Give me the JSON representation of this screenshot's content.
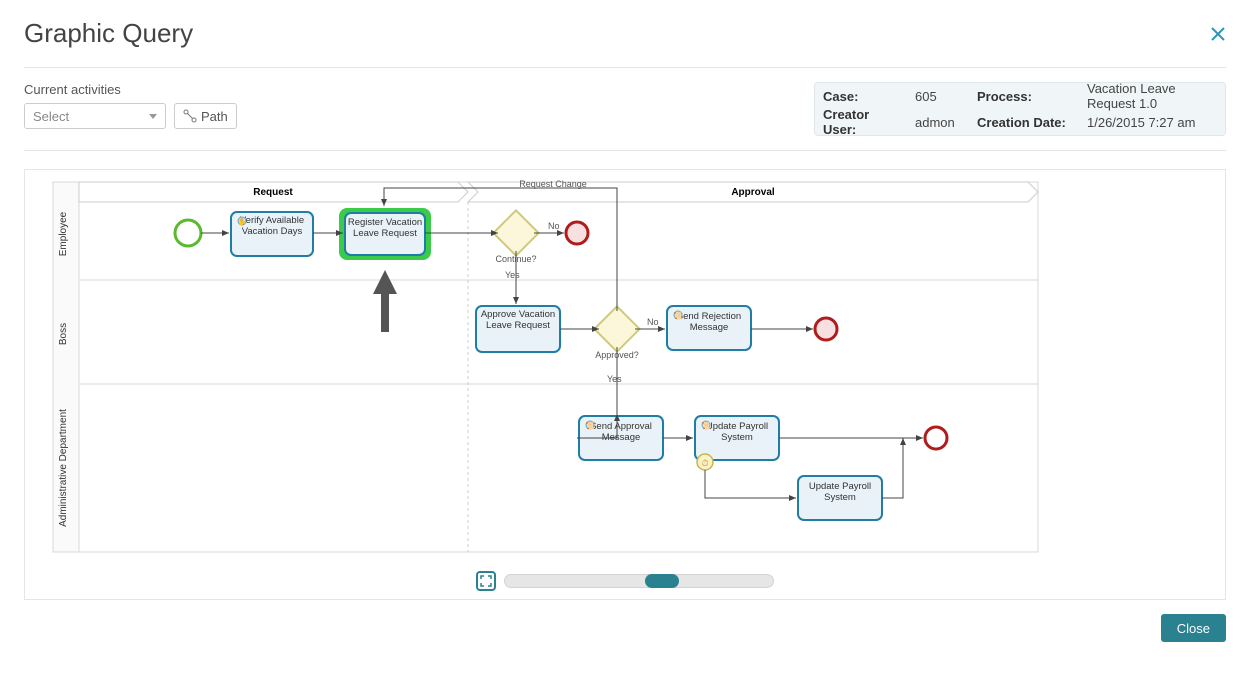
{
  "title": "Graphic Query",
  "controls": {
    "activities_label": "Current activities",
    "select_placeholder": "Select",
    "path_label": "Path"
  },
  "info": {
    "case_label": "Case:",
    "case_value": "605",
    "process_label": "Process:",
    "process_value": "Vacation Leave Request 1.0",
    "creator_label": "Creator User:",
    "creator_value": "admon",
    "date_label": "Creation Date:",
    "date_value": "1/26/2015 7:27 am"
  },
  "diagram": {
    "lanes": [
      "Employee",
      "Boss",
      "Administrative Department"
    ],
    "phases": [
      "Request",
      "Approval"
    ],
    "tasks": {
      "verify": "Verify Available Vacation Days",
      "register": "Register Vacation Leave Request",
      "approve": "Approve Vacation Leave Request",
      "reject_msg": "Send Rejection Message",
      "approve_msg": "Send Approval Message",
      "payroll1": "Update Payroll System",
      "payroll2": "Update Payroll System"
    },
    "gateways": {
      "continue": "Continue?",
      "approved": "Approved?"
    },
    "edges": {
      "request_change": "Request Change",
      "no": "No",
      "yes": "Yes"
    }
  },
  "buttons": {
    "close": "Close"
  }
}
